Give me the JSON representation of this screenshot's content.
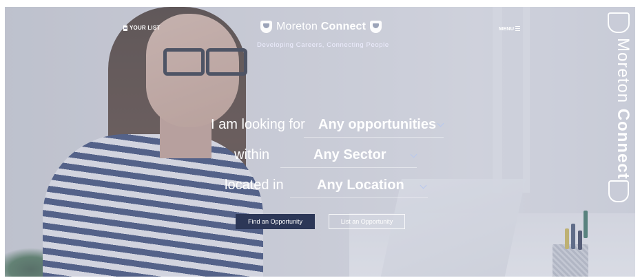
{
  "header": {
    "your_list": "YOUR LIST",
    "brand_light": "Moreton",
    "brand_bold": "Connect",
    "tagline": "Developing Careers, Connecting People",
    "menu": "MENU"
  },
  "side_brand": {
    "light": "Moreton",
    "bold": "Connect"
  },
  "search": {
    "line1_label": "I am looking for",
    "line1_value": "Any opportunities",
    "line2_label": "within",
    "line2_value": "Any Sector",
    "line3_label": "located in",
    "line3_value": "Any Location"
  },
  "buttons": {
    "find": "Find an Opportunity",
    "list": "List an Opportunity"
  },
  "icons": [
    "document-icon",
    "crest-icon",
    "shield-icon",
    "hamburger-icon",
    "chevron-down-icon"
  ],
  "colors": {
    "primary_button": "#2c3757",
    "chevron": "#b8c8ee"
  }
}
